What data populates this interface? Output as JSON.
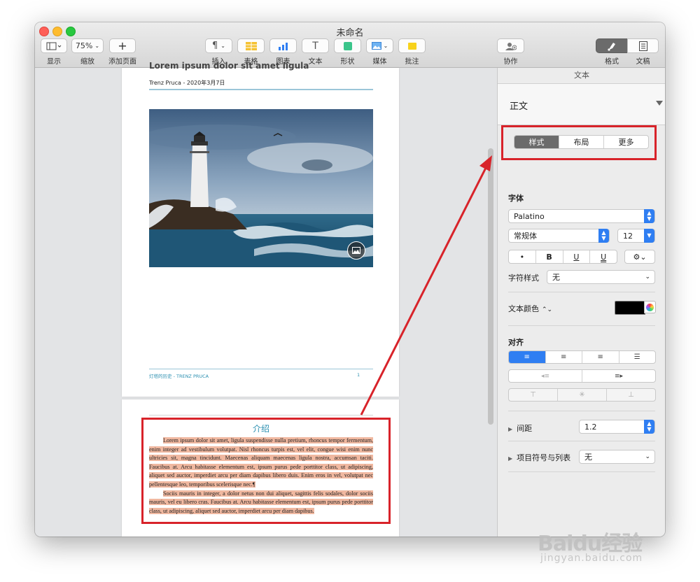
{
  "window": {
    "title": "未命名"
  },
  "toolbar": {
    "view_label": "显示",
    "zoom_value": "75%",
    "zoom_label": "缩放",
    "add_page_label": "添加页面",
    "insert_label": "插入",
    "table_label": "表格",
    "chart_label": "图表",
    "text_label": "文本",
    "shape_label": "形状",
    "media_label": "媒体",
    "comment_label": "批注",
    "collaborate_label": "协作",
    "format_label": "格式",
    "document_label": "文稿"
  },
  "page1": {
    "title_partial": "Lorem ipsum dolor sit amet ligula",
    "subtitle": "Trenz Pruca - 2020年3月7日",
    "footer_left": "灯塔的历史 - TRENZ PRUCA",
    "footer_right": "1"
  },
  "page2": {
    "heading": "介绍",
    "paragraph1": "Lorem ipsum dolor sit amet, ligula suspendisse nulla pretium, rhoncus tempor fermentum, enim integer ad vestibulum volutpat. Nisl rhoncus turpis est, vel elit, congue wisi enim nunc ultricies sit, magna tincidunt. Maecenas aliquam maecenas ligula nostra, accumsan taciti. Faucibus at. Arcu habitasse elementum est, ipsum purus pede porttitor class, ut adipiscing, aliquet sed auctor, imperdiet arcu per diam dapibus libero duis. Enim eros in vel, volutpat nec pellentesque leo, temporibus scelerisque nec.¶",
    "paragraph2": "Sociis mauris in integer, a dolor netus non dui aliquet, sagittis felis sodales, dolor sociis mauris, vel eu libero cras. Faucibus at. Arcu habitasse elementum est, ipsum purus pede porttitor class, ut adipiscing, aliquet sed auctor, imperdiet arcu per diam dapibus."
  },
  "inspector": {
    "header": "文本",
    "paragraph_style": "正文",
    "tabs": [
      "样式",
      "布局",
      "更多"
    ],
    "font_section": "字体",
    "font_family": "Palatino",
    "font_weight": "常规体",
    "font_size": "12",
    "format_buttons": [
      "•",
      "B",
      "U",
      "U"
    ],
    "char_style_label": "字符样式",
    "char_style_value": "无",
    "text_color_label": "文本颜色",
    "text_color_value": "#000000",
    "align_section": "对齐",
    "spacing_label": "间距",
    "spacing_value": "1.2",
    "bullets_label": "项目符号与列表",
    "bullets_value": "无"
  },
  "watermark": {
    "brand": "Baidu经验",
    "url": "jingyan.baidu.com"
  },
  "colors": {
    "accent": "#2f7ef2",
    "highlight_box": "#d8232a",
    "heading_teal": "#2a8fb0"
  }
}
